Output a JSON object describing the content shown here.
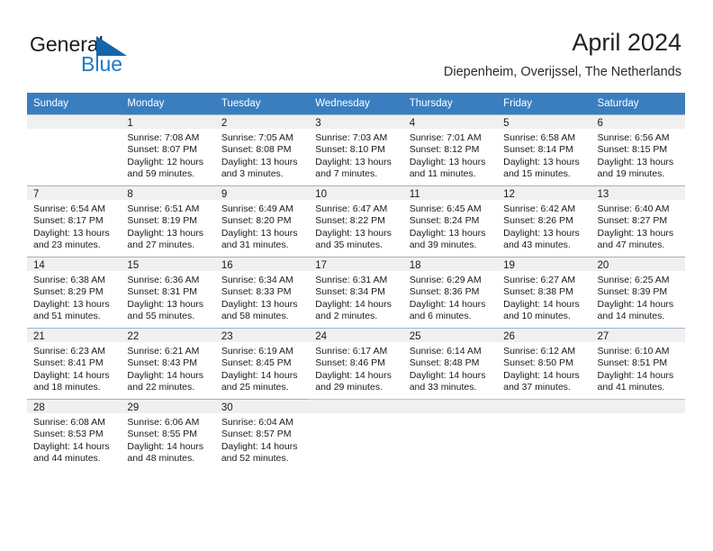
{
  "brand": {
    "name_part1": "General",
    "name_part2": "Blue",
    "accent_color": "#1165a8",
    "text_color": "#1b79c9"
  },
  "header": {
    "title": "April 2024",
    "subtitle": "Diepenheim, Overijssel, The Netherlands"
  },
  "calendar": {
    "header_bg": "#3a7ebf",
    "weekday_headers": [
      "Sunday",
      "Monday",
      "Tuesday",
      "Wednesday",
      "Thursday",
      "Friday",
      "Saturday"
    ],
    "weeks": [
      [
        {
          "day": "",
          "sunrise": "",
          "sunset": "",
          "daylight": "",
          "empty": true
        },
        {
          "day": "1",
          "sunrise": "Sunrise: 7:08 AM",
          "sunset": "Sunset: 8:07 PM",
          "daylight": "Daylight: 12 hours and 59 minutes."
        },
        {
          "day": "2",
          "sunrise": "Sunrise: 7:05 AM",
          "sunset": "Sunset: 8:08 PM",
          "daylight": "Daylight: 13 hours and 3 minutes."
        },
        {
          "day": "3",
          "sunrise": "Sunrise: 7:03 AM",
          "sunset": "Sunset: 8:10 PM",
          "daylight": "Daylight: 13 hours and 7 minutes."
        },
        {
          "day": "4",
          "sunrise": "Sunrise: 7:01 AM",
          "sunset": "Sunset: 8:12 PM",
          "daylight": "Daylight: 13 hours and 11 minutes."
        },
        {
          "day": "5",
          "sunrise": "Sunrise: 6:58 AM",
          "sunset": "Sunset: 8:14 PM",
          "daylight": "Daylight: 13 hours and 15 minutes."
        },
        {
          "day": "6",
          "sunrise": "Sunrise: 6:56 AM",
          "sunset": "Sunset: 8:15 PM",
          "daylight": "Daylight: 13 hours and 19 minutes."
        }
      ],
      [
        {
          "day": "7",
          "sunrise": "Sunrise: 6:54 AM",
          "sunset": "Sunset: 8:17 PM",
          "daylight": "Daylight: 13 hours and 23 minutes."
        },
        {
          "day": "8",
          "sunrise": "Sunrise: 6:51 AM",
          "sunset": "Sunset: 8:19 PM",
          "daylight": "Daylight: 13 hours and 27 minutes."
        },
        {
          "day": "9",
          "sunrise": "Sunrise: 6:49 AM",
          "sunset": "Sunset: 8:20 PM",
          "daylight": "Daylight: 13 hours and 31 minutes."
        },
        {
          "day": "10",
          "sunrise": "Sunrise: 6:47 AM",
          "sunset": "Sunset: 8:22 PM",
          "daylight": "Daylight: 13 hours and 35 minutes."
        },
        {
          "day": "11",
          "sunrise": "Sunrise: 6:45 AM",
          "sunset": "Sunset: 8:24 PM",
          "daylight": "Daylight: 13 hours and 39 minutes."
        },
        {
          "day": "12",
          "sunrise": "Sunrise: 6:42 AM",
          "sunset": "Sunset: 8:26 PM",
          "daylight": "Daylight: 13 hours and 43 minutes."
        },
        {
          "day": "13",
          "sunrise": "Sunrise: 6:40 AM",
          "sunset": "Sunset: 8:27 PM",
          "daylight": "Daylight: 13 hours and 47 minutes."
        }
      ],
      [
        {
          "day": "14",
          "sunrise": "Sunrise: 6:38 AM",
          "sunset": "Sunset: 8:29 PM",
          "daylight": "Daylight: 13 hours and 51 minutes."
        },
        {
          "day": "15",
          "sunrise": "Sunrise: 6:36 AM",
          "sunset": "Sunset: 8:31 PM",
          "daylight": "Daylight: 13 hours and 55 minutes."
        },
        {
          "day": "16",
          "sunrise": "Sunrise: 6:34 AM",
          "sunset": "Sunset: 8:33 PM",
          "daylight": "Daylight: 13 hours and 58 minutes."
        },
        {
          "day": "17",
          "sunrise": "Sunrise: 6:31 AM",
          "sunset": "Sunset: 8:34 PM",
          "daylight": "Daylight: 14 hours and 2 minutes."
        },
        {
          "day": "18",
          "sunrise": "Sunrise: 6:29 AM",
          "sunset": "Sunset: 8:36 PM",
          "daylight": "Daylight: 14 hours and 6 minutes."
        },
        {
          "day": "19",
          "sunrise": "Sunrise: 6:27 AM",
          "sunset": "Sunset: 8:38 PM",
          "daylight": "Daylight: 14 hours and 10 minutes."
        },
        {
          "day": "20",
          "sunrise": "Sunrise: 6:25 AM",
          "sunset": "Sunset: 8:39 PM",
          "daylight": "Daylight: 14 hours and 14 minutes."
        }
      ],
      [
        {
          "day": "21",
          "sunrise": "Sunrise: 6:23 AM",
          "sunset": "Sunset: 8:41 PM",
          "daylight": "Daylight: 14 hours and 18 minutes."
        },
        {
          "day": "22",
          "sunrise": "Sunrise: 6:21 AM",
          "sunset": "Sunset: 8:43 PM",
          "daylight": "Daylight: 14 hours and 22 minutes."
        },
        {
          "day": "23",
          "sunrise": "Sunrise: 6:19 AM",
          "sunset": "Sunset: 8:45 PM",
          "daylight": "Daylight: 14 hours and 25 minutes."
        },
        {
          "day": "24",
          "sunrise": "Sunrise: 6:17 AM",
          "sunset": "Sunset: 8:46 PM",
          "daylight": "Daylight: 14 hours and 29 minutes."
        },
        {
          "day": "25",
          "sunrise": "Sunrise: 6:14 AM",
          "sunset": "Sunset: 8:48 PM",
          "daylight": "Daylight: 14 hours and 33 minutes."
        },
        {
          "day": "26",
          "sunrise": "Sunrise: 6:12 AM",
          "sunset": "Sunset: 8:50 PM",
          "daylight": "Daylight: 14 hours and 37 minutes."
        },
        {
          "day": "27",
          "sunrise": "Sunrise: 6:10 AM",
          "sunset": "Sunset: 8:51 PM",
          "daylight": "Daylight: 14 hours and 41 minutes."
        }
      ],
      [
        {
          "day": "28",
          "sunrise": "Sunrise: 6:08 AM",
          "sunset": "Sunset: 8:53 PM",
          "daylight": "Daylight: 14 hours and 44 minutes."
        },
        {
          "day": "29",
          "sunrise": "Sunrise: 6:06 AM",
          "sunset": "Sunset: 8:55 PM",
          "daylight": "Daylight: 14 hours and 48 minutes."
        },
        {
          "day": "30",
          "sunrise": "Sunrise: 6:04 AM",
          "sunset": "Sunset: 8:57 PM",
          "daylight": "Daylight: 14 hours and 52 minutes."
        },
        {
          "day": "",
          "sunrise": "",
          "sunset": "",
          "daylight": "",
          "empty": true
        },
        {
          "day": "",
          "sunrise": "",
          "sunset": "",
          "daylight": "",
          "empty": true
        },
        {
          "day": "",
          "sunrise": "",
          "sunset": "",
          "daylight": "",
          "empty": true
        },
        {
          "day": "",
          "sunrise": "",
          "sunset": "",
          "daylight": "",
          "empty": true
        }
      ]
    ]
  }
}
